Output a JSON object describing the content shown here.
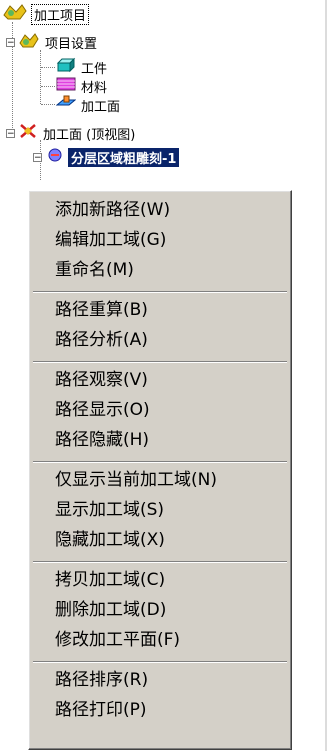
{
  "tree": {
    "root_label": "加工项目",
    "project_settings_label": "项目设置",
    "workpiece_label": "工件",
    "material_label": "材料",
    "machining_plane_label": "加工面",
    "machining_view_label": "加工面 (顶视图)",
    "selected_item_label": "分层区域粗雕刻-1"
  },
  "context_menu": {
    "add_new_path": "添加新路径(W)",
    "edit_machining_region": "编辑加工域(G)",
    "rename": "重命名(M)",
    "recompute_path": "路径重算(B)",
    "analyze_path": "路径分析(A)",
    "observe_path": "路径观察(V)",
    "show_path": "路径显示(O)",
    "hide_path": "路径隐藏(H)",
    "show_only_current_region": "仅显示当前加工域(N)",
    "show_machining_region": "显示加工域(S)",
    "hide_machining_region": "隐藏加工域(X)",
    "copy_machining_region": "拷贝加工域(C)",
    "delete_machining_region": "删除加工域(D)",
    "modify_machining_plane": "修改加工平面(F)",
    "sort_paths": "路径排序(R)",
    "print_paths": "路径打印(P)"
  },
  "icons": {
    "root": "project-folder-icon",
    "settings": "settings-folder-icon",
    "workpiece": "workpiece-box-icon",
    "material": "material-swatch-icon",
    "plane": "machining-plane-icon",
    "view": "machining-view-icon",
    "toolpath": "toolpath-icon"
  },
  "colors": {
    "menu_bg": "#d4d0c8",
    "selection_bg": "#0a246a",
    "tree_bg": "#ffffff"
  }
}
